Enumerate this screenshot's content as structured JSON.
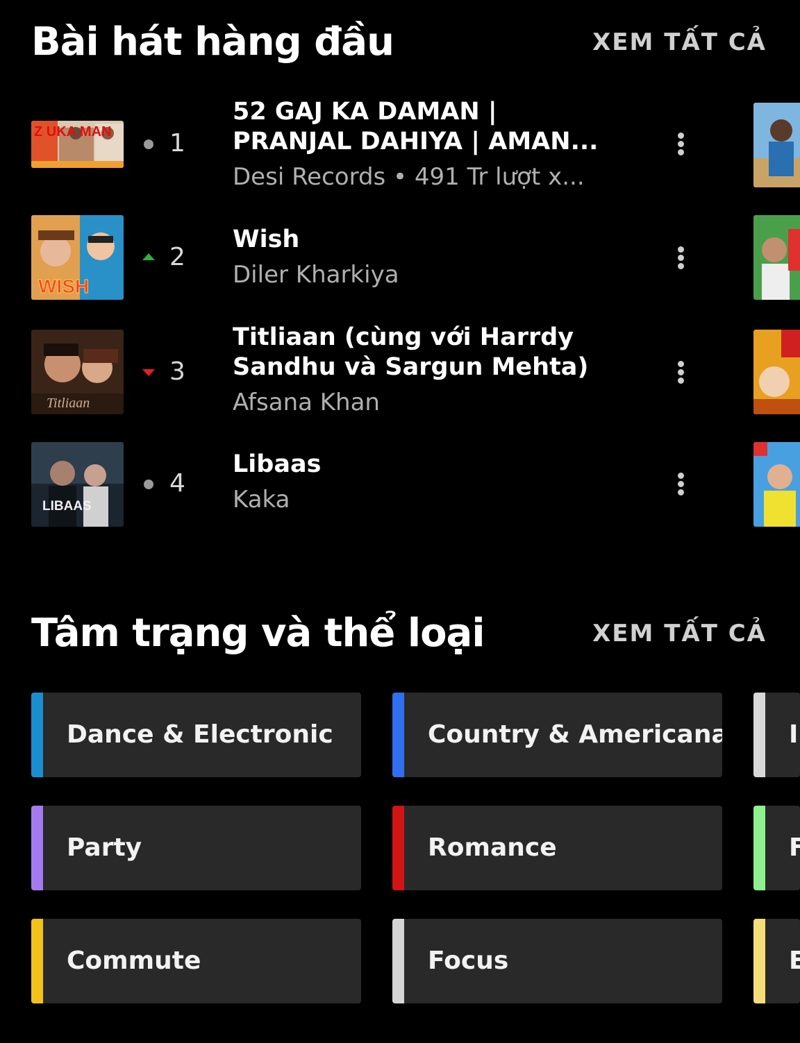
{
  "top_songs": {
    "title": "Bài hát hàng đầu",
    "see_all": "XEM TẤT CẢ",
    "items": [
      {
        "rank": "1",
        "trend": "same",
        "title": "52 GAJ KA DAMAN | PRANJAL DAHIYA | AMAN...",
        "subtitle": "Desi Records • 491 Tr lượt x...",
        "thumb_text": "Z UKA MAN"
      },
      {
        "rank": "2",
        "trend": "up",
        "title": "Wish",
        "subtitle": "Diler Kharkiya",
        "thumb_text": "WISH"
      },
      {
        "rank": "3",
        "trend": "down",
        "title": "Titliaan (cùng với Harrdy Sandhu và Sargun Mehta)",
        "subtitle": "Afsana Khan",
        "thumb_text": "Titliaan"
      },
      {
        "rank": "4",
        "trend": "same",
        "title": "Libaas",
        "subtitle": "Kaka",
        "thumb_text": "LIBAAS"
      }
    ]
  },
  "moods": {
    "title": "Tâm trạng và thể loại",
    "see_all": "XEM TẤT CẢ",
    "cards": [
      {
        "label": "Dance & Electronic",
        "color": "#1a8fd0"
      },
      {
        "label": "Country & Americana",
        "color": "#2f6ff0"
      },
      {
        "label": "In",
        "color": "#d8d8d8"
      },
      {
        "label": "Party",
        "color": "#a57af0"
      },
      {
        "label": "Romance",
        "color": "#d11414"
      },
      {
        "label": "F",
        "color": "#8ef08e"
      },
      {
        "label": "Commute",
        "color": "#f2c21b"
      },
      {
        "label": "Focus",
        "color": "#d5d5d5"
      },
      {
        "label": "E",
        "color": "#f5de7a"
      }
    ]
  },
  "colors": {
    "background": "#000000",
    "trend_up": "#2bb33a",
    "trend_down": "#e61e1e",
    "trend_same": "#9a9a9a"
  }
}
